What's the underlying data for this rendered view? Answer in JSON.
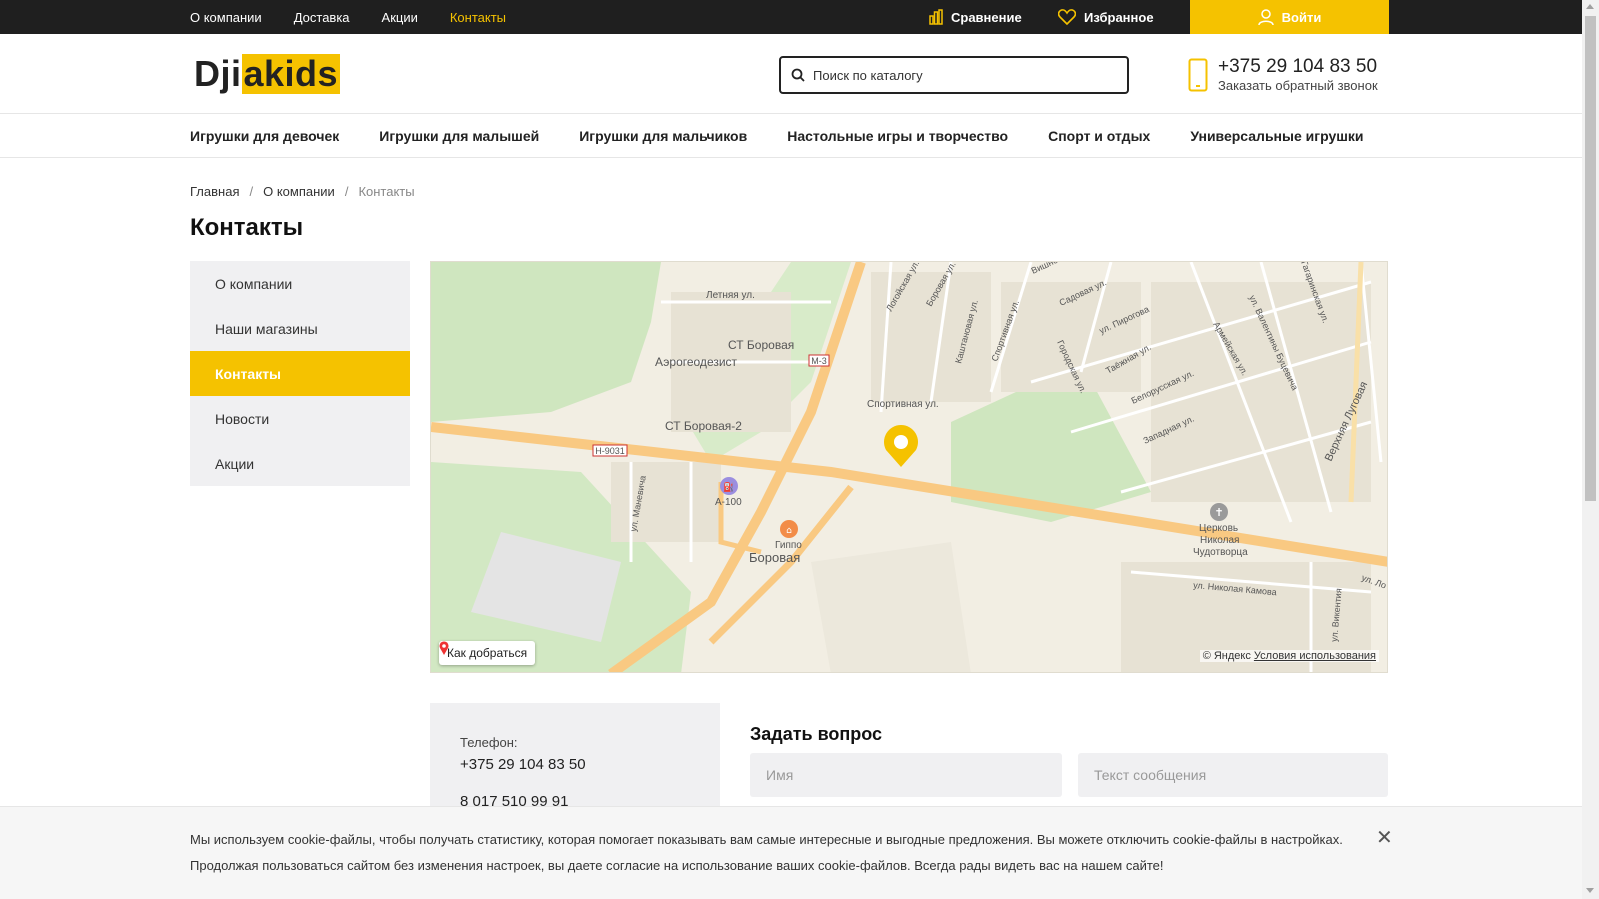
{
  "topbar": {
    "nav": [
      {
        "label": "О компании",
        "active": false
      },
      {
        "label": "Доставка",
        "active": false
      },
      {
        "label": "Акции",
        "active": false
      },
      {
        "label": "Контакты",
        "active": true
      }
    ],
    "compare_label": "Сравнение",
    "favorites_label": "Избранное",
    "login_label": "Войти"
  },
  "header": {
    "logo_part1": "Dji",
    "logo_part2": "akids",
    "search_placeholder": "Поиск по каталогу",
    "phone": "+375 29 104 83 50",
    "callback_label": "Заказать обратный звонок"
  },
  "catnav": [
    "Игрушки для девочек",
    "Игрушки для малышей",
    "Игрушки для мальчиков",
    "Настольные игры и творчество",
    "Спорт и отдых",
    "Универсальные игрушки"
  ],
  "breadcrumbs": [
    "Главная",
    "О компании",
    "Контакты"
  ],
  "page_title": "Контакты",
  "sidebar": [
    {
      "label": "О компании",
      "active": false
    },
    {
      "label": "Наши магазины",
      "active": false
    },
    {
      "label": "Контакты",
      "active": true
    },
    {
      "label": "Новости",
      "active": false
    },
    {
      "label": "Акции",
      "active": false
    }
  ],
  "map": {
    "labels": {
      "letnaya": "Летняя ул.",
      "st_borovaya": "СТ Боровая",
      "aerogeo": "Аэрогеодезист",
      "st_borovaya2": "СТ Боровая-2",
      "m3": "М-3",
      "n9031": "Н-9031",
      "a100": "А-100",
      "gippo": "Гиппо",
      "borovaya": "Боровая",
      "sportivnaya": "Спортивная ул.",
      "logoyskaya": "Логойская ул.",
      "borovaya_ul": "Боровая ул.",
      "vishnev": "Вишнев",
      "sadovaya": "Садовая ул.",
      "pirogova": "ул. Пирогова",
      "kashtanovaya": "Каштановая ул.",
      "sportivnaya2": "Спортивная ул.",
      "gorodskaya": "Городская ул.",
      "tayezhnaya": "Таёжная ул.",
      "belorusskaya": "Белорусская ул.",
      "zapadnaya": "Западная ул.",
      "armeyskaya": "Армейская ул.",
      "valentiny": "ул. Валентины Буцевича",
      "verkhnyaya": "Верхняя Луговая",
      "manevicha": "ул. Маневича",
      "church1": "Церковь",
      "church2": "Николая",
      "church3": "Чудотворца",
      "kamova": "ул. Николая Камова",
      "vikentiya": "ул. Викентия",
      "gagarinskaya": "Гагаринская ул.",
      "ulu": "ул. Ло"
    },
    "route_label": "Как добраться",
    "copyright": "© Яндекс",
    "terms": "Условия использования",
    "colors": {
      "highway": "#f9c982",
      "road": "#ffffff",
      "green": "#cfe6bf",
      "marker": "#f5c200"
    }
  },
  "contacts": {
    "phone_label": "Телефон:",
    "phone1": "+375 29 104 83 50",
    "phone2": "8 017 510 99 91"
  },
  "form": {
    "title": "Задать вопрос",
    "name_placeholder": "Имя",
    "message_placeholder": "Текст сообщения"
  },
  "cookie": {
    "line1": "Мы используем cookie-файлы, чтобы получать статистику, которая помогает показывать вам самые интересные и выгодные предложения. Вы можете отключить cookie-файлы в настройках.",
    "line2": "Продолжая пользоваться сайтом без изменения настроек, вы даете согласие на использование ваших cookie-файлов. Всегда рады видеть вас на нашем сайте!"
  },
  "colors": {
    "accent": "#f5c200",
    "topbar": "#1f1f1f"
  }
}
